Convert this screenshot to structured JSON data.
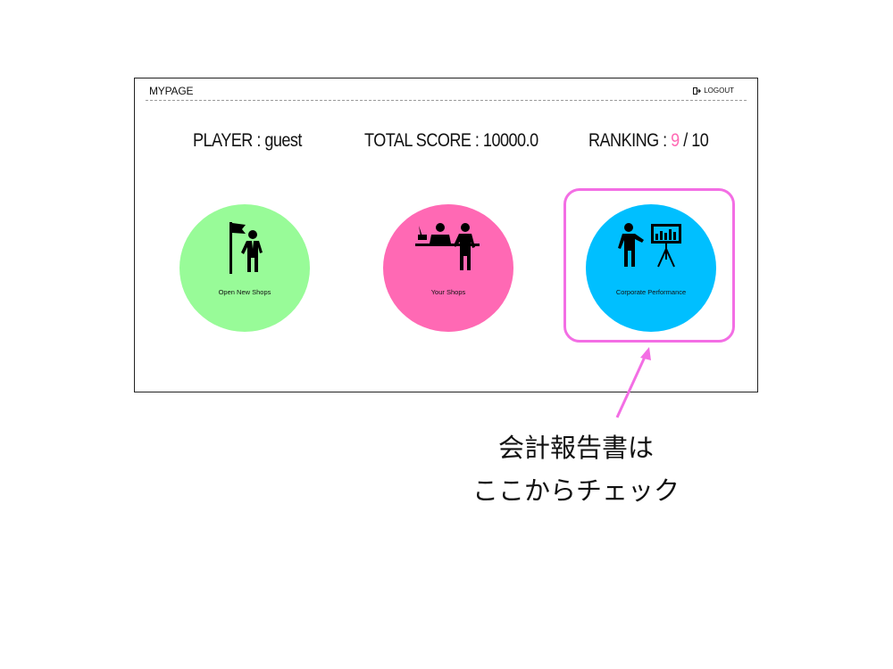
{
  "header": {
    "title": "MYPAGE",
    "logout_label": "LOGOUT"
  },
  "stats": {
    "player": "PLAYER : guest",
    "total_score": "TOTAL SCORE : 10000.0",
    "ranking_prefix": "RANKING : ",
    "ranking_current": "9",
    "ranking_suffix": " / 10"
  },
  "menu": [
    {
      "label": "Open New Shops",
      "icon": "flag-person-icon",
      "color": "#98fb98"
    },
    {
      "label": "Your Shops",
      "icon": "shop-counter-icon",
      "color": "#ff69b4"
    },
    {
      "label": "Corporate Performance",
      "icon": "presentation-chart-icon",
      "color": "#00bfff"
    }
  ],
  "annotation": {
    "line1": "会計報告書は",
    "line2": "ここからチェック",
    "color": "#f36ee4"
  }
}
